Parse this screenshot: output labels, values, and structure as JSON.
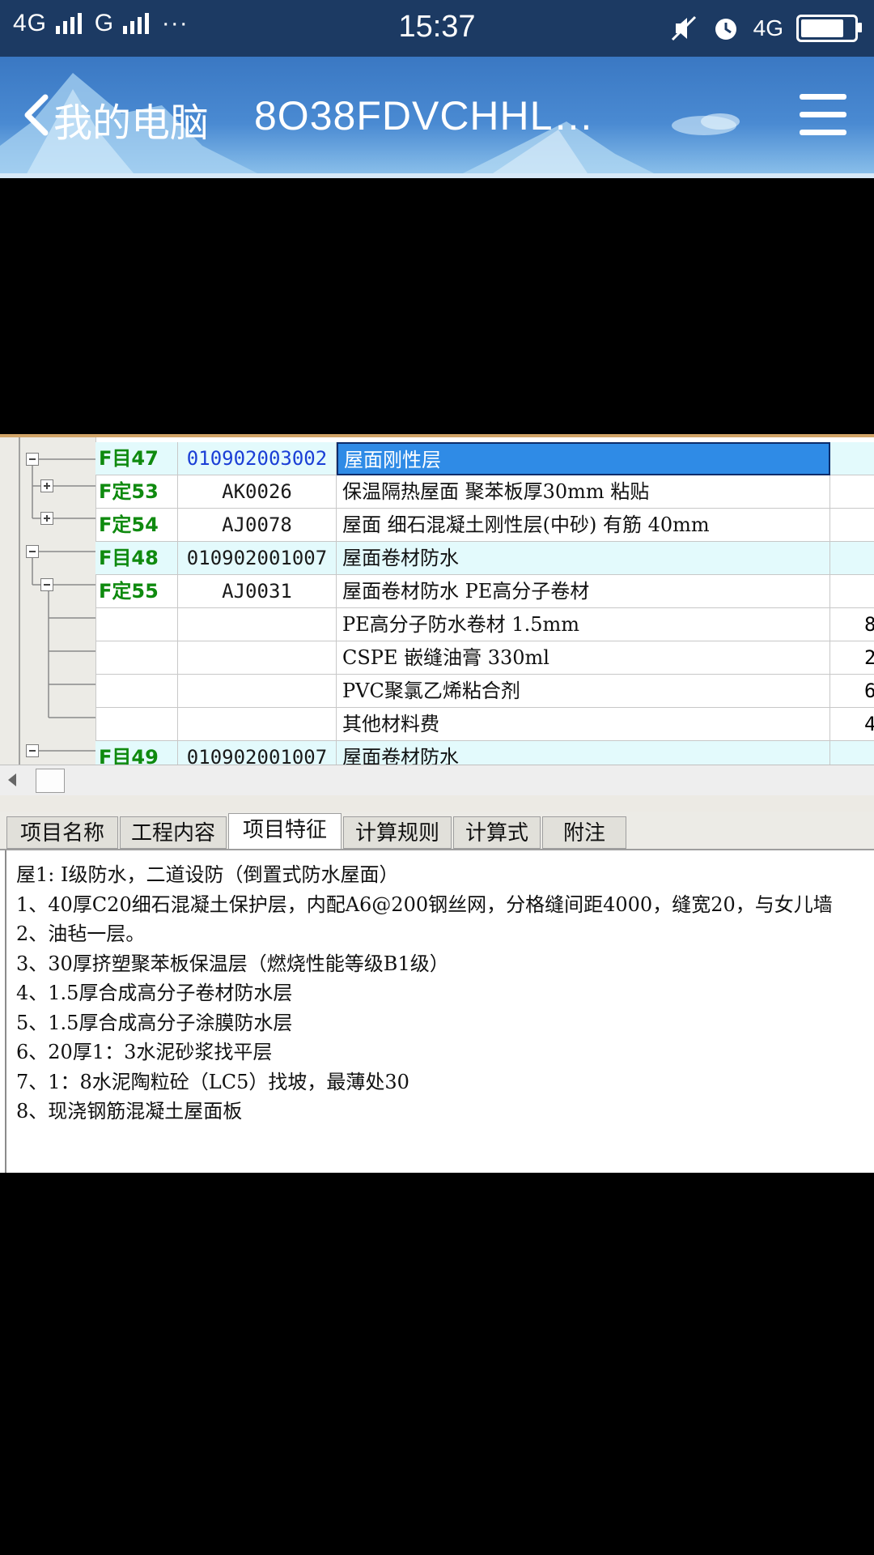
{
  "status_bar": {
    "network_1": "4G",
    "network_2": "G",
    "more": "···",
    "time": "15:37",
    "network_3": "4G",
    "icons": [
      "signal-icon",
      "mute-icon",
      "alarm-icon",
      "battery-icon"
    ],
    "battery_level": 0.9
  },
  "header": {
    "title": "我的电脑",
    "device": "8O38FDVCHHL…",
    "colors": {
      "top": "#3a78c3",
      "bottom": "#8ec3ec"
    }
  },
  "grid": {
    "rows": [
      {
        "type": "F目47",
        "code": "010902003002",
        "name": "屋面刚性层",
        "qty": "",
        "kind": "bill",
        "selected": true
      },
      {
        "type": "F定53",
        "code": "AK0026",
        "name": "保温隔热屋面 聚苯板厚30mm 粘贴",
        "qty": "",
        "kind": "quota"
      },
      {
        "type": "F定54",
        "code": "AJ0078",
        "name": "屋面 细石混凝土刚性层(中砂) 有筋 40mm",
        "qty": "",
        "kind": "quota"
      },
      {
        "type": "F目48",
        "code": "010902001007",
        "name": "屋面卷材防水",
        "qty": "",
        "kind": "bill"
      },
      {
        "type": "F定55",
        "code": "AJ0031",
        "name": "屋面卷材防水 PE高分子卷材",
        "qty": "",
        "kind": "quota"
      },
      {
        "type": "",
        "code": "",
        "name": "PE高分子防水卷材 1.5mm",
        "qty": "8",
        "kind": "material"
      },
      {
        "type": "",
        "code": "",
        "name": "CSPE 嵌缝油膏 330ml",
        "qty": "2",
        "kind": "material"
      },
      {
        "type": "",
        "code": "",
        "name": "PVC聚氯乙烯粘合剂",
        "qty": "6",
        "kind": "material"
      },
      {
        "type": "",
        "code": "",
        "name": "其他材料费",
        "qty": "4",
        "kind": "material"
      },
      {
        "type": "F目49",
        "code": "010902001007",
        "name": "屋面卷材防水",
        "qty": "",
        "kind": "bill"
      }
    ]
  },
  "tabs": [
    {
      "label": "项目名称",
      "active": false
    },
    {
      "label": "工程内容",
      "active": false
    },
    {
      "label": "项目特征",
      "active": true
    },
    {
      "label": "计算规则",
      "active": false
    },
    {
      "label": "计算式",
      "active": false
    },
    {
      "label": "附注",
      "active": false
    }
  ],
  "description": [
    "屋1: I级防水，二道设防（倒置式防水屋面）",
    "1、40厚C20细石混凝土保护层，内配A6@200钢丝网，分格缝间距4000，缝宽20，与女儿墙",
    "2、油毡一层。",
    "3、30厚挤塑聚苯板保温层（燃烧性能等级B1级）",
    "4、1.5厚合成高分子卷材防水层",
    "5、1.5厚合成高分子涂膜防水层",
    "6、20厚1：3水泥砂浆找平层",
    "7、1：8水泥陶粒砼（LC5）找坡，最薄处30",
    "8、现浇钢筋混凝土屋面板"
  ]
}
